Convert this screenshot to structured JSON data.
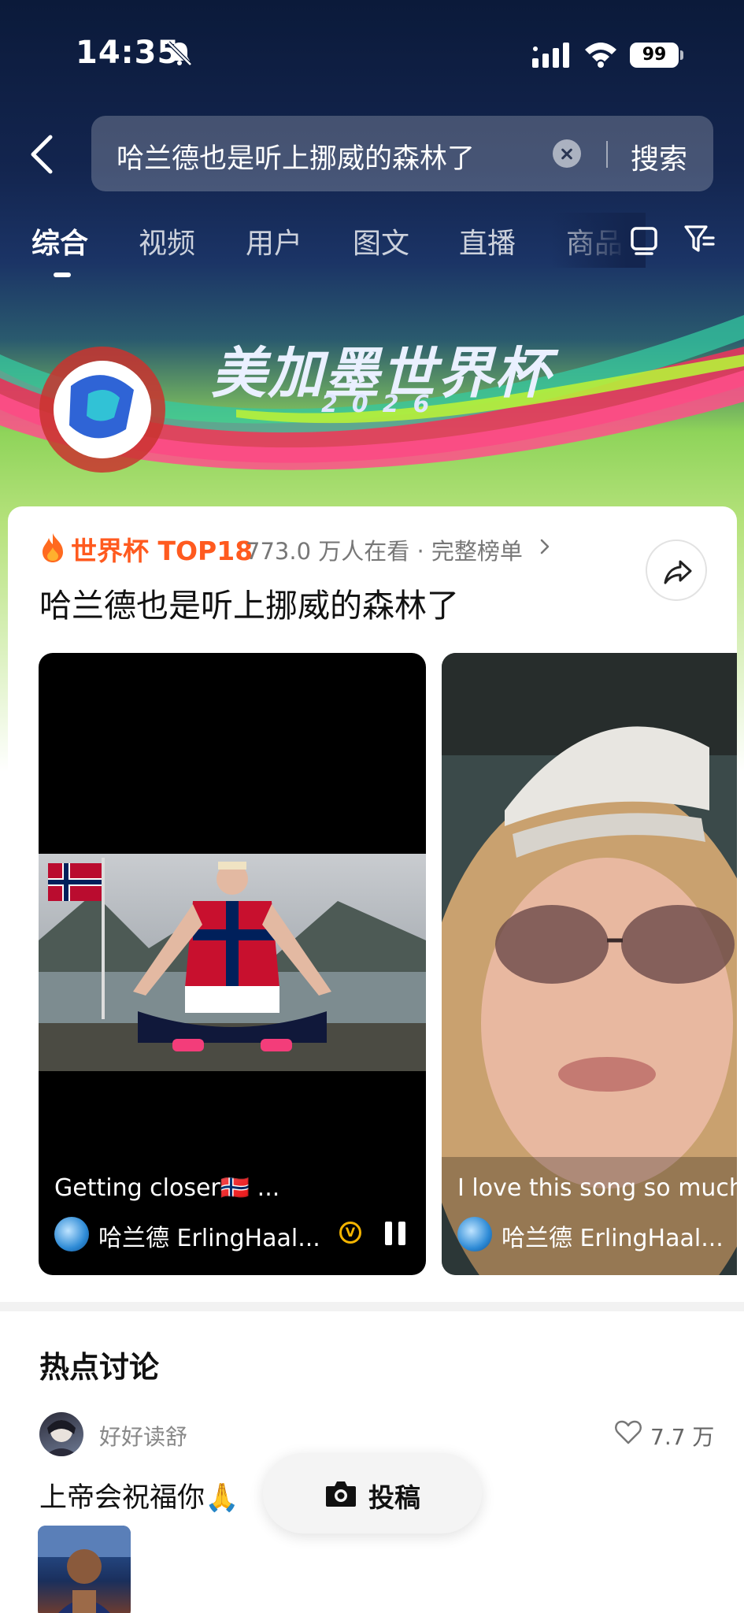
{
  "status": {
    "time": "14:35",
    "battery": "99"
  },
  "search": {
    "query": "哈兰德也是听上挪威的森林了",
    "button": "搜索"
  },
  "tabs": [
    {
      "label": "综合",
      "active": true
    },
    {
      "label": "视频"
    },
    {
      "label": "用户"
    },
    {
      "label": "图文"
    },
    {
      "label": "直播"
    },
    {
      "label": "商品"
    }
  ],
  "banner": {
    "title": "美加墨世界杯",
    "year": "2026"
  },
  "hot": {
    "label": "世界杯 TOP18",
    "meta": "773.0 万人在看 · 完整榜单",
    "title": "哈兰德也是听上挪威的森林了"
  },
  "videos": [
    {
      "caption": "Getting closer🇳🇴 ...",
      "user": "哈兰德 ErlingHaal...",
      "badge": "V"
    },
    {
      "caption": "I love this song so much",
      "user": "哈兰德 ErlingHaal..."
    }
  ],
  "discussion": {
    "title": "热点讨论",
    "post": {
      "user": "好好读舒",
      "likes": "7.7 万",
      "text": "上帝会祝福你🙏"
    }
  },
  "fab": {
    "label": "投稿"
  },
  "colors": {
    "accent": "#ff5a1f",
    "header_bg": "#0b1a3a"
  },
  "icons": [
    "bell-off-icon",
    "signal-icon",
    "wifi-icon",
    "back-icon",
    "clear-icon",
    "window-icon",
    "filter-icon",
    "flame-icon",
    "share-icon",
    "pause-icon",
    "heart-icon",
    "camera-icon"
  ]
}
